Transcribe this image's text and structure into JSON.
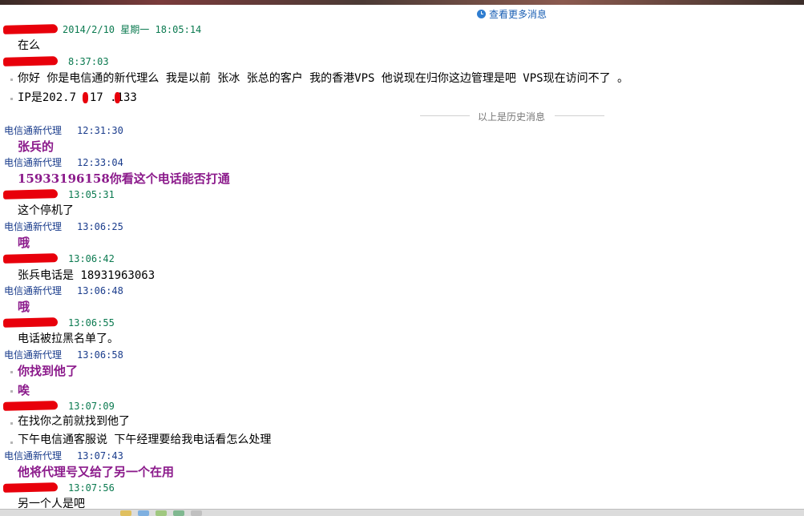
{
  "history": {
    "more_label": "查看更多消息",
    "divider_label": "以上是历史消息"
  },
  "messages": [
    {
      "sender": "",
      "time": "2014/2/10 星期一 18:05:14",
      "lines": [
        "在么"
      ]
    },
    {
      "sender": "",
      "time": "8:37:03",
      "lines": [
        "你好 你是电信通的新代理么 我是以前 张冰 张总的客户 我的香港VPS 他说现在归你这边管理是吧   VPS现在访问不了 。",
        "IP是202.7 .17 .133"
      ]
    },
    {
      "sender": "电信通新代理",
      "time": "12:31:30",
      "lines": [
        "张兵的"
      ]
    },
    {
      "sender": "电信通新代理",
      "time": "12:33:04",
      "lines": [
        "15933196158你看这个电话能否打通"
      ]
    },
    {
      "sender": "",
      "time": "13:05:31",
      "lines": [
        "这个停机了"
      ]
    },
    {
      "sender": "电信通新代理",
      "time": "13:06:25",
      "lines": [
        "哦"
      ]
    },
    {
      "sender": "",
      "time": "13:06:42",
      "lines": [
        "张兵电话是 18931963063"
      ]
    },
    {
      "sender": "电信通新代理",
      "time": "13:06:48",
      "lines": [
        "哦"
      ]
    },
    {
      "sender": "",
      "time": "13:06:55",
      "lines": [
        "电话被拉黑名单了。"
      ]
    },
    {
      "sender": "电信通新代理",
      "time": "13:06:58",
      "lines": [
        "你找到他了",
        "唉"
      ]
    },
    {
      "sender": "",
      "time": "13:07:09",
      "lines": [
        "在找你之前就找到他了",
        "下午电信通客服说 下午经理要给我电话看怎么处理"
      ]
    },
    {
      "sender": "电信通新代理",
      "time": "13:07:43",
      "lines": [
        "他将代理号又给了另一个在用"
      ]
    },
    {
      "sender": "",
      "time": "13:07:56",
      "lines": [
        "另一个人是吧"
      ]
    }
  ]
}
